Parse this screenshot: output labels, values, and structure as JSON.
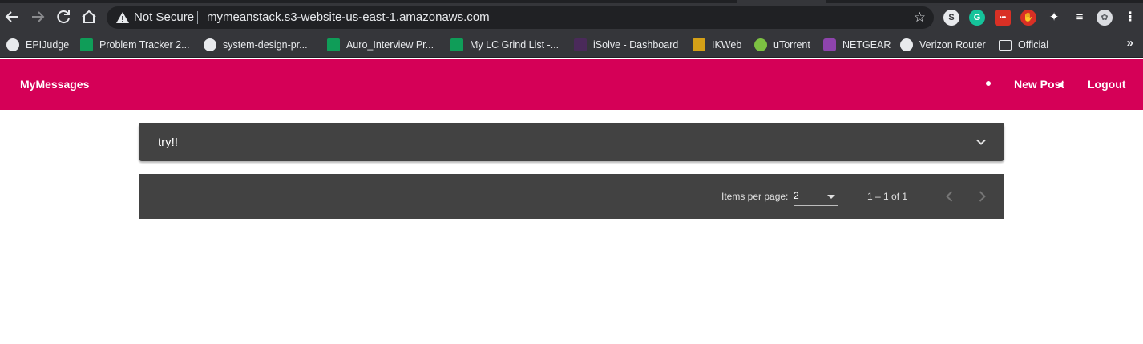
{
  "browser": {
    "security_label": "Not Secure",
    "url": "mymeanstack.s3-website-us-east-1.amazonaws.com",
    "bookmarks": [
      {
        "label": "EPIJudge",
        "icon": "globe-icon"
      },
      {
        "label": "Problem Tracker 2...",
        "icon": "sheets-icon"
      },
      {
        "label": "system-design-pr...",
        "icon": "github-icon"
      },
      {
        "label": "Auro_Interview Pr...",
        "icon": "sheets-icon"
      },
      {
        "label": "My LC Grind List -...",
        "icon": "sheets-icon"
      },
      {
        "label": "iSolve - Dashboard",
        "icon": "isolve-icon"
      },
      {
        "label": "IKWeb",
        "icon": "ikweb-icon"
      },
      {
        "label": "uTorrent",
        "icon": "utorrent-icon"
      },
      {
        "label": "NETGEAR",
        "icon": "netgear-icon"
      },
      {
        "label": "Verizon Router",
        "icon": "globe-icon"
      },
      {
        "label": "Official",
        "icon": "folder-icon"
      }
    ],
    "more_bookmarks": "»"
  },
  "app": {
    "brand": "MyMessages",
    "nav": {
      "new_post": "New Post",
      "logout": "Logout"
    },
    "accent_color": "#d50057"
  },
  "posts": [
    {
      "title": "try!!"
    }
  ],
  "paginator": {
    "items_per_page_label": "Items per page:",
    "page_size": "2",
    "range_label": "1 – 1 of 1"
  }
}
